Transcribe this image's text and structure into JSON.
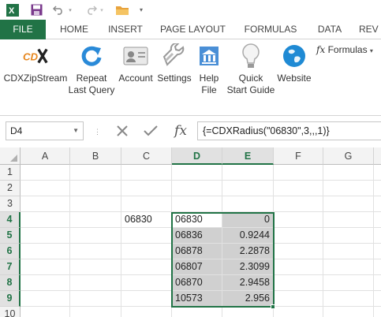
{
  "colors": {
    "accent": "#217346",
    "save_icon": "#7a3a8c",
    "selection_shade": "#d0d0d0"
  },
  "quick_access": {
    "icons": [
      "excel-icon",
      "save-icon",
      "undo-icon",
      "redo-icon",
      "open-folder-icon",
      "customize-icon"
    ]
  },
  "tabs": [
    "FILE",
    "HOME",
    "INSERT",
    "PAGE LAYOUT",
    "FORMULAS",
    "DATA",
    "REV"
  ],
  "ribbon": {
    "buttons": [
      {
        "label": "CDXZipStream",
        "icon": "cdx-logo-icon"
      },
      {
        "label": "Repeat\nLast Query",
        "icon": "refresh-icon"
      },
      {
        "label": "Account",
        "icon": "account-card-icon"
      },
      {
        "label": "Settings",
        "icon": "wrench-icon"
      },
      {
        "label": "Help\nFile",
        "icon": "help-book-icon"
      },
      {
        "label": "Quick\nStart Guide",
        "icon": "lightbulb-icon"
      },
      {
        "label": "Website",
        "icon": "globe-icon"
      }
    ],
    "formulas_label": "Formulas",
    "formulas_fx": "fx"
  },
  "formula_bar": {
    "name_box": "D4",
    "fx": "fx",
    "formula": "{=CDXRadius(\"06830\",3,,,1)}"
  },
  "grid": {
    "columns": [
      "A",
      "B",
      "C",
      "D",
      "E",
      "F",
      "G"
    ],
    "selected_columns": [
      "D",
      "E"
    ],
    "rows": [
      1,
      2,
      3,
      4,
      5,
      6,
      7,
      8,
      9,
      10
    ],
    "selected_rows": [
      4,
      5,
      6,
      7,
      8,
      9
    ],
    "c4": "06830",
    "d_values": [
      "06830",
      "06836",
      "06878",
      "06807",
      "06870",
      "10573"
    ],
    "e_values": [
      "0",
      "0.9244",
      "2.2878",
      "2.3099",
      "2.9458",
      "2.956"
    ]
  }
}
